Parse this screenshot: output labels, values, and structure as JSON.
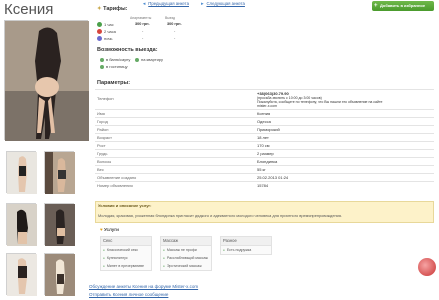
{
  "title": "Ксения",
  "nav": {
    "prev": "Предыдущая анкета",
    "next": "Следующая анкета"
  },
  "add_button": "Добавить в избранное",
  "rates": {
    "heading": "Тарифы:",
    "col_apartments": "Апартаменты",
    "col_outcall": "Выезд",
    "rows": [
      {
        "label": "1 час",
        "apartments": "300 грн.",
        "outcall": "300 грн.",
        "color": "#4aa04a"
      },
      {
        "label": "2 часа",
        "apartments": "-",
        "outcall": "-",
        "color": "#d7463e"
      },
      {
        "label": "ночь",
        "apartments": "-",
        "outcall": "-",
        "color": "#6b6bd0"
      }
    ]
  },
  "outcall": {
    "heading": "Возможность выезда:",
    "items": [
      "в баню/сауну",
      "на квартиру",
      "в гостиницу"
    ]
  },
  "params": {
    "heading": "Параметры:",
    "phone_label": "Телефон",
    "phone_number": "+38(063)30.79.90",
    "phone_note_1": "(просьба звонить с 10:00 до 3:00 часов)",
    "phone_note_2": "Пожалуйста, сообщите по телефону, что Вы нашли это объявление на сайте",
    "phone_note_3": "mister-x.com",
    "rows": [
      {
        "k": "Имя",
        "v": "Ксения"
      },
      {
        "k": "Город",
        "v": "Одесса"
      },
      {
        "k": "Район",
        "v": "Приморский"
      },
      {
        "k": "Возраст",
        "v": "18 лет"
      },
      {
        "k": "Рост",
        "v": "170 см"
      },
      {
        "k": "Грудь",
        "v": "2 размер"
      },
      {
        "k": "Волосы",
        "v": "Блондинка"
      },
      {
        "k": "Вес",
        "v": "55 кг"
      },
      {
        "k": "Объявление создано",
        "v": "25.02.2013 01:24"
      },
      {
        "k": "Номер объявления",
        "v": "15784"
      }
    ]
  },
  "terms": {
    "heading": "Условия и описание услуг:",
    "text": "Молодая, красивая, ухоженная блондинка пригласит дядкого и адекватного молодого человека для приятного времяпрепровождения."
  },
  "services": {
    "heading": "Услуги",
    "columns": [
      {
        "title": "Секс",
        "items": [
          "Классический секс",
          "Куннилингус",
          "Минет в презервативе"
        ]
      },
      {
        "title": "Массаж",
        "items": [
          "Массаж не профи",
          "Расслабляющий массаж",
          "Эротический массаж"
        ]
      },
      {
        "title": "Разное",
        "items": [
          "Есть подружка"
        ]
      }
    ]
  },
  "links": {
    "discuss": "Обсуждение анкеты Ксения на форуме Mister-x.com",
    "message": "Отправить Ксения личное сообщение"
  }
}
